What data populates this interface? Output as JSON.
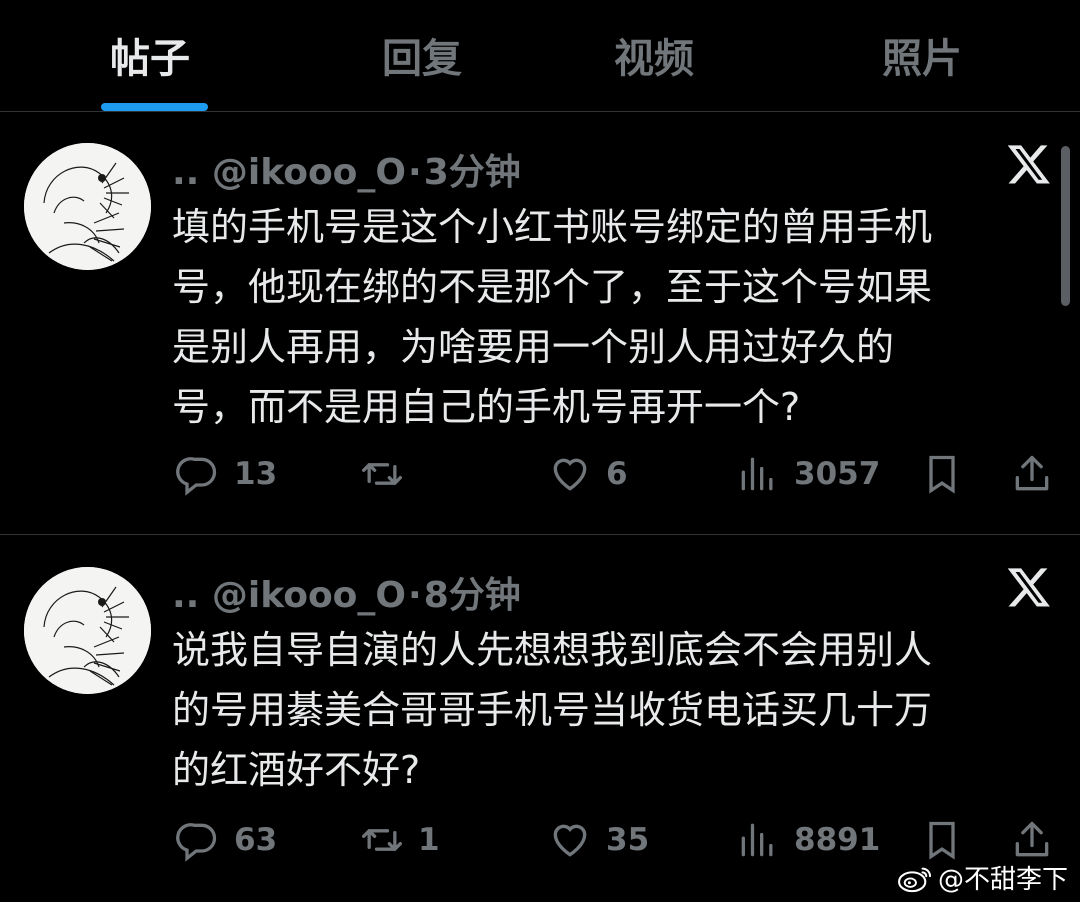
{
  "tabs": [
    {
      "label": "帖子",
      "active": true
    },
    {
      "label": "回复",
      "active": false
    },
    {
      "label": "视频",
      "active": false
    },
    {
      "label": "照片",
      "active": false
    }
  ],
  "posts": [
    {
      "name": "..",
      "handle": "@ikooo_O",
      "separator": "·",
      "time": "3分钟",
      "text_lines": [
        "填的手机号是这个小红书账号绑定的曾用手机",
        "号，他现在绑的不是那个了，至于这个号如果",
        "是别人再用，为啥要用一个别人用过好久的",
        "号，而不是用自己的手机号再开一个?"
      ],
      "replies": "13",
      "retweets": "",
      "likes": "6",
      "views": "3057"
    },
    {
      "name": "..",
      "handle": "@ikooo_O",
      "separator": "·",
      "time": "8分钟",
      "text_lines": [
        "说我自导自演的人先想想我到底会不会用别人",
        "的号用綦美合哥哥手机号当收货电话买几十万",
        "的红酒好不好?"
      ],
      "replies": "63",
      "retweets": "1",
      "likes": "35",
      "views": "8891"
    }
  ],
  "watermark": "@不甜李下",
  "colors": {
    "background": "#000000",
    "text": "#e7e9ea",
    "muted": "#71767b",
    "accent": "#1d9bf0",
    "divider": "#2f3336"
  },
  "icons": {
    "reply": "reply-icon",
    "retweet": "retweet-icon",
    "like": "heart-icon",
    "views": "views-icon",
    "bookmark": "bookmark-icon",
    "share": "share-icon",
    "brand": "x-logo-icon",
    "watermark": "weibo-icon"
  }
}
